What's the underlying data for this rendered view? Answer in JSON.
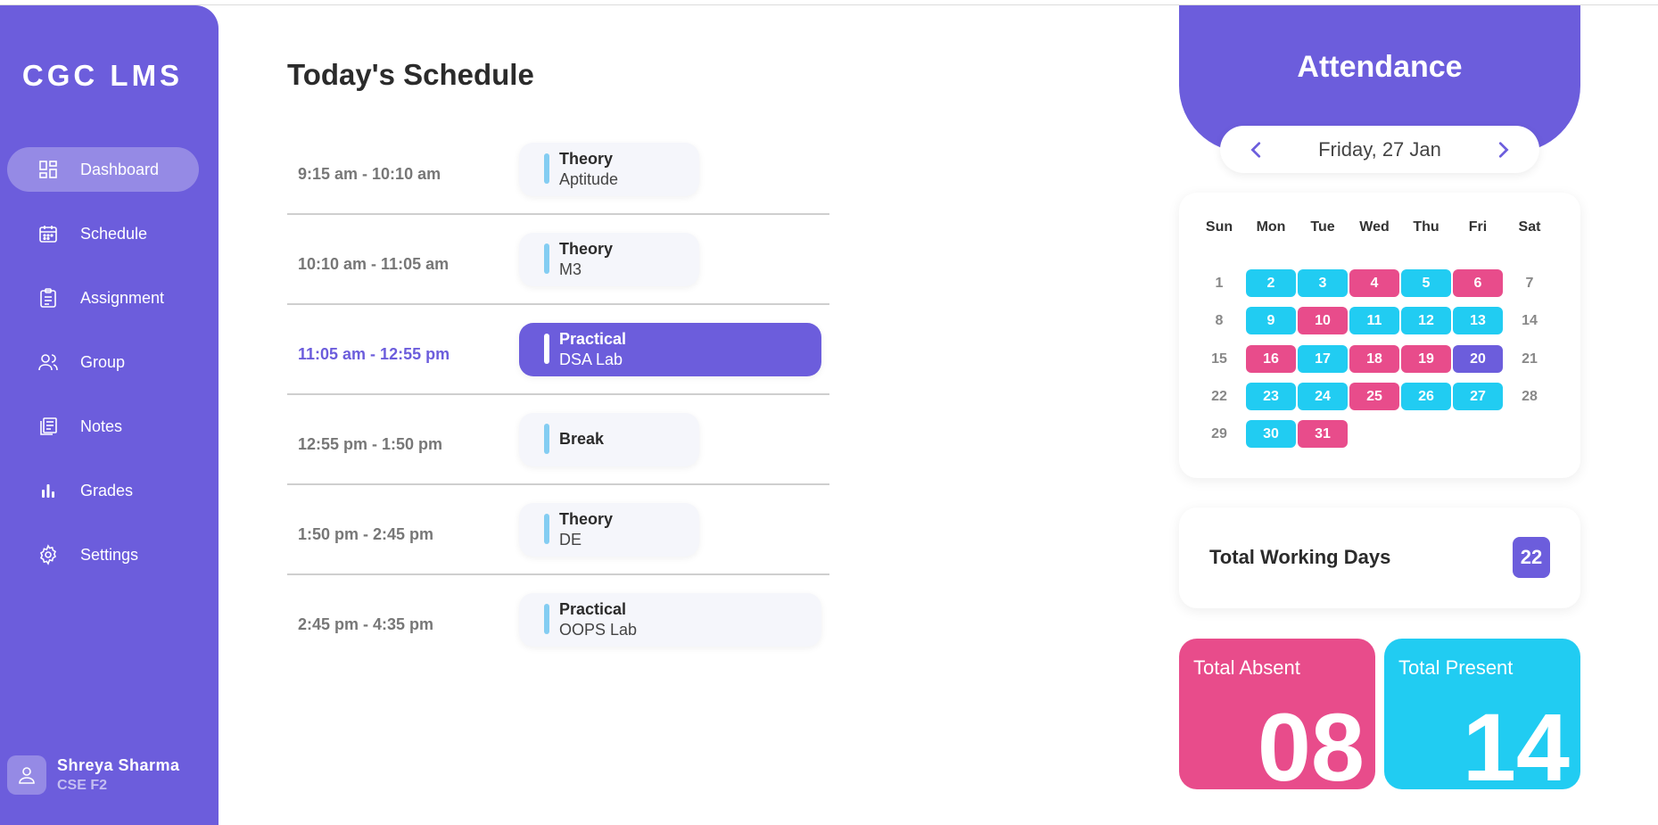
{
  "sidebar": {
    "brand": "CGC LMS",
    "items": [
      {
        "label": "Dashboard",
        "icon": "dashboard-icon",
        "active": true
      },
      {
        "label": "Schedule",
        "icon": "calendar-icon"
      },
      {
        "label": "Assignment",
        "icon": "clipboard-icon"
      },
      {
        "label": "Group",
        "icon": "users-icon"
      },
      {
        "label": "Notes",
        "icon": "notes-icon"
      },
      {
        "label": "Grades",
        "icon": "bar-chart-icon"
      },
      {
        "label": "Settings",
        "icon": "gear-icon"
      }
    ],
    "user": {
      "name": "Shreya Sharma",
      "class": "CSE F2",
      "icon": "user-icon"
    }
  },
  "schedule": {
    "title": "Today's Schedule",
    "rows": [
      {
        "time": "9:15 am - 10:10 am",
        "kind": "Theory",
        "subject": "Aptitude"
      },
      {
        "time": "10:10 am - 11:05 am",
        "kind": "Theory",
        "subject": "M3"
      },
      {
        "time": "11:05 am - 12:55 pm",
        "kind": "Practical",
        "subject": "DSA Lab",
        "current": true
      },
      {
        "time": "12:55 pm - 1:50 pm",
        "kind": "Break",
        "subject": ""
      },
      {
        "time": "1:50 pm - 2:45 pm",
        "kind": "Theory",
        "subject": "DE"
      },
      {
        "time": "2:45 pm - 4:35 pm",
        "kind": "Practical",
        "subject": "OOPS Lab"
      }
    ]
  },
  "attendance": {
    "title": "Attendance",
    "date": "Friday, 27 Jan",
    "weekdays": [
      "Sun",
      "Mon",
      "Tue",
      "Wed",
      "Thu",
      "Fri",
      "Sat"
    ],
    "weeks": [
      [
        [
          "1",
          ""
        ],
        [
          "2",
          "p"
        ],
        [
          "3",
          "p"
        ],
        [
          "4",
          "a"
        ],
        [
          "5",
          "p"
        ],
        [
          "6",
          "a"
        ],
        [
          "7",
          ""
        ]
      ],
      [
        [
          "8",
          ""
        ],
        [
          "9",
          "p"
        ],
        [
          "10",
          "a"
        ],
        [
          "11",
          "p"
        ],
        [
          "12",
          "p"
        ],
        [
          "13",
          "p"
        ],
        [
          "14",
          ""
        ]
      ],
      [
        [
          "15",
          ""
        ],
        [
          "16",
          "a"
        ],
        [
          "17",
          "p"
        ],
        [
          "18",
          "a"
        ],
        [
          "19",
          "a"
        ],
        [
          "20",
          "t"
        ],
        [
          "21",
          ""
        ]
      ],
      [
        [
          "22",
          ""
        ],
        [
          "23",
          "p"
        ],
        [
          "24",
          "p"
        ],
        [
          "25",
          "a"
        ],
        [
          "26",
          "p"
        ],
        [
          "27",
          "p"
        ],
        [
          "28",
          ""
        ]
      ],
      [
        [
          "29",
          ""
        ],
        [
          "30",
          "p"
        ],
        [
          "31",
          "a"
        ]
      ]
    ],
    "total_working_days_label": "Total Working Days",
    "total_working_days": "22",
    "absent_label": "Total Absent",
    "absent": "08",
    "present_label": "Total Present",
    "present": "14",
    "colors": {
      "accent": "#6c5ddc",
      "present": "#21ccf2",
      "absent": "#e84c8b"
    }
  }
}
